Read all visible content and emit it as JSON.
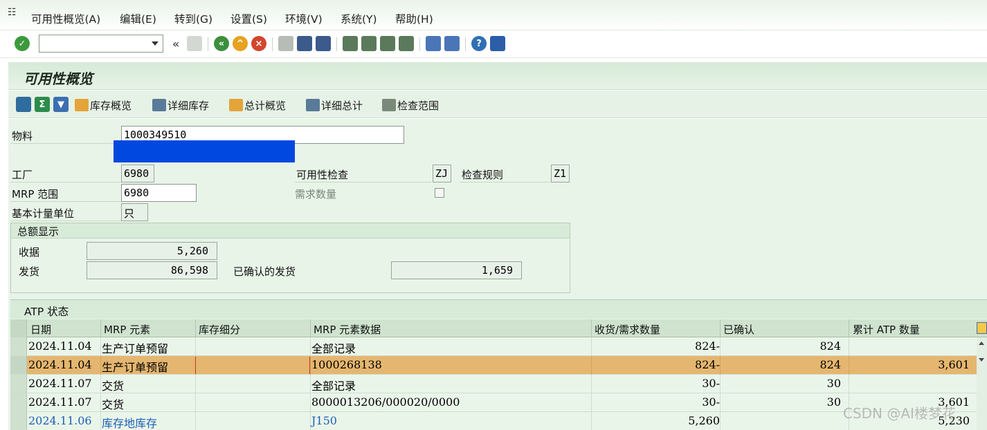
{
  "menu": {
    "items": [
      "可用性概览(A)",
      "编辑(E)",
      "转到(G)",
      "设置(S)",
      "环境(V)",
      "系统(Y)",
      "帮助(H)"
    ]
  },
  "toolbar": {
    "command_value": "",
    "icons": [
      "check-icon",
      "back-icon",
      "exit-icon",
      "cancel-icon",
      "print-icon",
      "find-icon",
      "find-next-icon",
      "first-page-icon",
      "prev-page-icon",
      "next-page-icon",
      "last-page-icon",
      "new-session-icon",
      "shortcut-icon",
      "help-icon",
      "layout-icon"
    ]
  },
  "title": "可用性概览",
  "app_toolbar": {
    "buttons": [
      {
        "label": "库存概览"
      },
      {
        "label": "详细库存"
      },
      {
        "label": "总计概览"
      },
      {
        "label": "详细总计"
      },
      {
        "label": "检查范围"
      }
    ]
  },
  "header": {
    "material_label": "物料",
    "material_value": "1000349510",
    "plant_label": "工厂",
    "plant_value": "6980",
    "mrp_area_label": "MRP 范围",
    "mrp_area_value": "6980",
    "uom_label": "基本计量单位",
    "uom_value": "只",
    "avail_check_label": "可用性检查",
    "avail_check_value": "ZJ",
    "check_rule_label": "检查规则",
    "check_rule_value": "Z1",
    "req_qty_label": "需求数量"
  },
  "totals": {
    "title": "总额显示",
    "receipts_label": "收据",
    "receipts_value": "5,260",
    "issues_label": "发货",
    "issues_value": "86,598",
    "confirmed_label": "已确认的发货",
    "confirmed_value": "1,659"
  },
  "atp": {
    "title": "ATP 状态",
    "columns": [
      "日期",
      "MRP 元素",
      "库存细分",
      "MRP 元素数据",
      "收货/需求数量",
      "已确认",
      "累计 ATP 数量"
    ],
    "rows": [
      {
        "date": "2024.11.04",
        "element": "生产订单预留",
        "segment": "",
        "data": "全部记录",
        "qty": "824-",
        "confirmed": "824",
        "cum": ""
      },
      {
        "date": "2024.11.04",
        "element": "生产订单预留",
        "segment": "",
        "data": "1000268138",
        "qty": "824-",
        "confirmed": "824",
        "cum": "3,601"
      },
      {
        "date": "2024.11.07",
        "element": "交货",
        "segment": "",
        "data": "全部记录",
        "qty": "30-",
        "confirmed": "30",
        "cum": ""
      },
      {
        "date": "2024.11.07",
        "element": "交货",
        "segment": "",
        "data": "8000013206/000020/0000",
        "qty": "30-",
        "confirmed": "30",
        "cum": "3,601"
      },
      {
        "date": "2024.11.06",
        "element": "库存地库存",
        "segment": "",
        "data": "J150",
        "qty": "5,260",
        "confirmed": "",
        "cum": "5,230"
      }
    ]
  },
  "watermark": "CSDN @AI楼梦花"
}
